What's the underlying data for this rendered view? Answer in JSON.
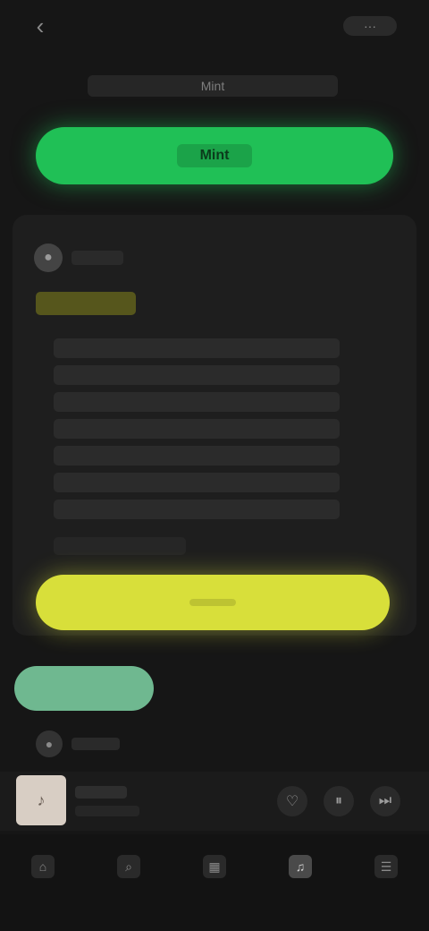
{
  "header": {
    "back_icon": "‹",
    "menu_label": "···",
    "headline": "Mint"
  },
  "primary_action": {
    "label": "Mint"
  },
  "card": {
    "avatar_icon": "●",
    "author": "",
    "title": "",
    "features": [
      "",
      "",
      "",
      "",
      "",
      "",
      "",
      ""
    ],
    "footnote": ""
  },
  "secondary_action": {
    "label": ""
  },
  "chip": {
    "label": ""
  },
  "small_row": {
    "icon": "●",
    "label": ""
  },
  "mini_player": {
    "art_icon": "♪",
    "title": "",
    "subtitle": "",
    "buttons": [
      "♡",
      "⏸",
      "⏭"
    ]
  },
  "bottom_nav": {
    "items": [
      {
        "icon": "⌂",
        "label": ""
      },
      {
        "icon": "⌕",
        "label": ""
      },
      {
        "icon": "▦",
        "label": ""
      },
      {
        "icon": "♫",
        "label": ""
      },
      {
        "icon": "☰",
        "label": ""
      }
    ],
    "active_index": 3
  }
}
